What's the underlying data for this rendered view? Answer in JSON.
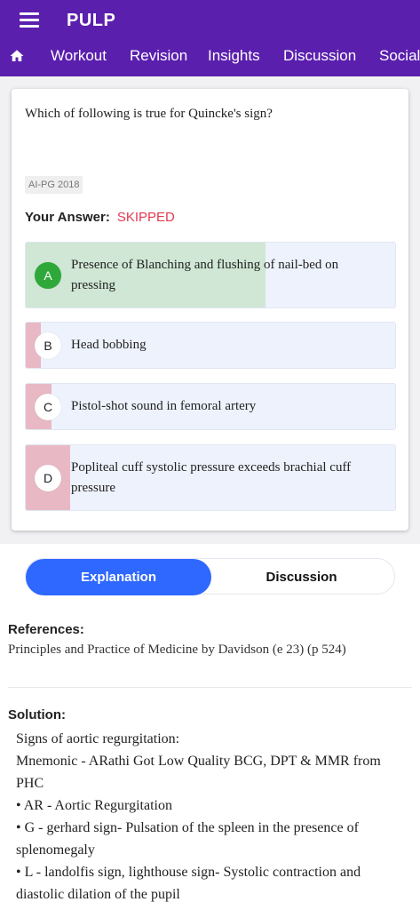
{
  "header": {
    "app_title": "PULP",
    "tabs": [
      "Workout",
      "Revision",
      "Insights",
      "Discussion",
      "Social"
    ]
  },
  "question": {
    "text": "Which of following is true for Quincke's sign?",
    "tag": "AI-PG 2018",
    "your_answer_label": "Your Answer:",
    "your_answer_value": "SKIPPED",
    "options": [
      {
        "letter": "A",
        "text": "Presence of Blanching and flushing of nail-bed on pressing",
        "percent": 65,
        "correct": true
      },
      {
        "letter": "B",
        "text": "Head bobbing",
        "percent": 4,
        "correct": false
      },
      {
        "letter": "C",
        "text": "Pistol-shot sound in femoral artery",
        "percent": 7,
        "correct": false
      },
      {
        "letter": "D",
        "text": "Popliteal cuff systolic pressure exceeds brachial cuff pressure",
        "percent": 12,
        "correct": false
      }
    ]
  },
  "toggle": {
    "explanation_label": "Explanation",
    "discussion_label": "Discussion"
  },
  "references": {
    "heading": "References:",
    "text": "Principles and Practice of Medicine by Davidson (e 23) (p 524)"
  },
  "solution": {
    "heading": "Solution:",
    "lines": [
      "Signs of aortic regurgitation:",
      "Mnemonic - ARathi Got Low Quality BCG, DPT & MMR from PHC",
      "• AR - Aortic Regurgitation",
      "• G - gerhard sign- Pulsation of the spleen in the presence of splenomegaly",
      "• L - landolfis sign, lighthouse sign- Systolic contraction and diastolic dilation of the pupil"
    ]
  },
  "colors": {
    "header": "#5b1fae",
    "correct_fill": "#cfe7d4",
    "wrong_fill": "#e8b9c4",
    "active_toggle": "#2f68ff",
    "skipped": "#e23a52"
  }
}
